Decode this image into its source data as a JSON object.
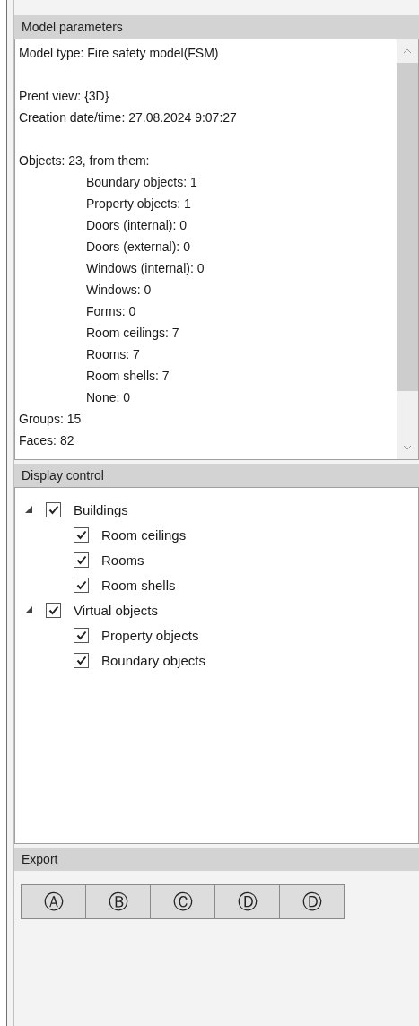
{
  "sections": [
    {
      "kind": "text",
      "title": "Model parameters",
      "lines": [
        {
          "kind": "text",
          "text": "Model type: Fire safety model(FSM)"
        },
        {
          "kind": "blank"
        },
        {
          "kind": "text",
          "text": "Prent view: {3D}"
        },
        {
          "kind": "text",
          "text": "Creation date/time: 27.08.2024 9:07:27"
        },
        {
          "kind": "blank"
        },
        {
          "kind": "text",
          "text": "Objects: 23, from them:",
          "children": [
            {
              "text": "Boundary objects: 1"
            },
            {
              "text": "Property objects: 1"
            },
            {
              "text": "Doors (internal): 0"
            },
            {
              "text": "Doors (external): 0"
            },
            {
              "text": "Windows (internal): 0"
            },
            {
              "text": "Windows: 0"
            },
            {
              "text": "Forms: 0"
            },
            {
              "text": "Room ceilings: 7"
            },
            {
              "text": "Rooms: 7"
            },
            {
              "text": "Room shells: 7"
            },
            {
              "text": "None: 0"
            }
          ]
        },
        {
          "kind": "text",
          "text": "Groups: 15"
        },
        {
          "kind": "text",
          "text": "Faces: 82"
        }
      ]
    },
    {
      "kind": "tree",
      "title": "Display control",
      "items": [
        {
          "label": "Buildings",
          "checked": true,
          "expanded": true,
          "children": [
            {
              "label": "Room ceilings",
              "checked": true
            },
            {
              "label": "Rooms",
              "checked": true
            },
            {
              "label": "Room shells",
              "checked": true
            }
          ]
        },
        {
          "label": "Virtual objects",
          "checked": true,
          "expanded": true,
          "children": [
            {
              "label": "Property objects",
              "checked": true
            },
            {
              "label": "Boundary objects",
              "checked": true
            }
          ]
        }
      ]
    },
    {
      "kind": "buttons",
      "title": "Export",
      "buttons": [
        "Ⓐ",
        "Ⓑ",
        "Ⓒ",
        "Ⓓ",
        "Ⓓ"
      ]
    }
  ]
}
